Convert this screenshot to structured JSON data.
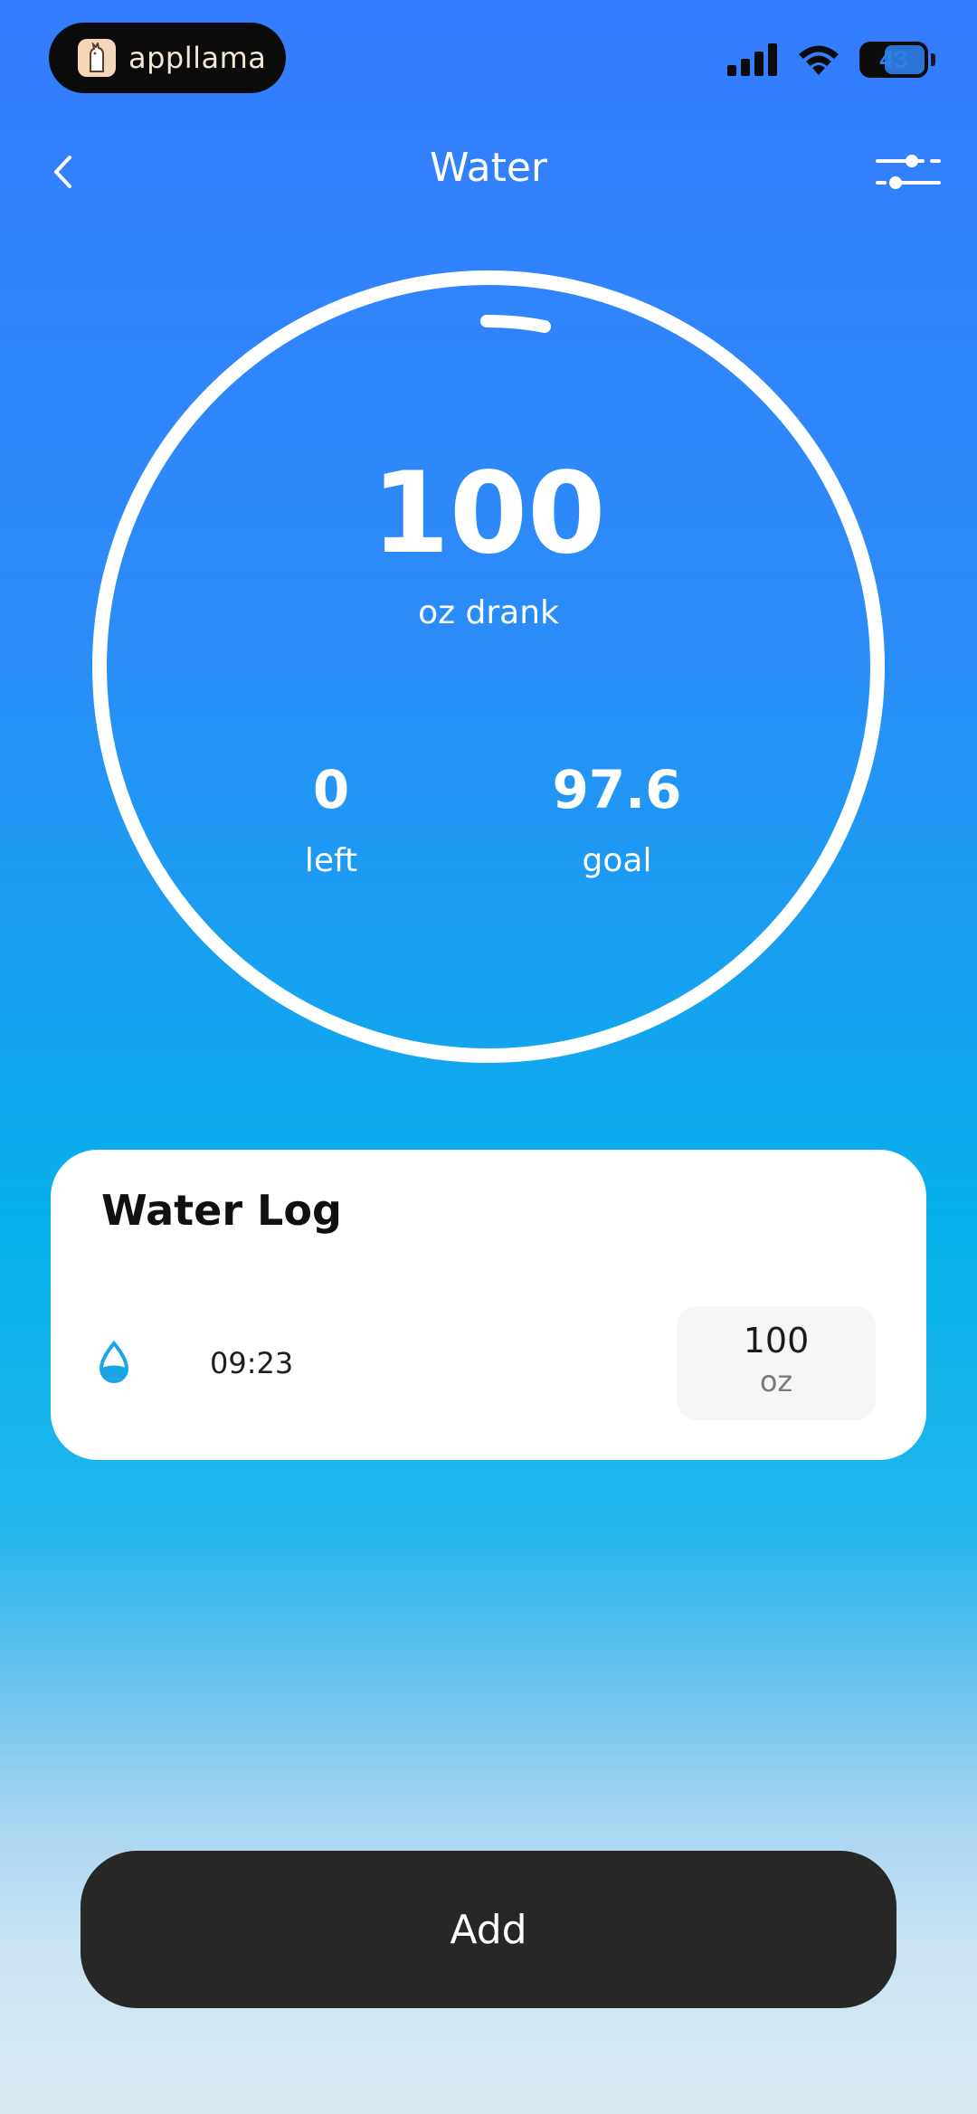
{
  "status_bar": {
    "brand": "appllama",
    "battery": "43"
  },
  "header": {
    "title": "Water"
  },
  "summary": {
    "drank_value": "100",
    "drank_label": "oz drank",
    "left_value": "0",
    "left_label": "left",
    "goal_value": "97.6",
    "goal_label": "goal",
    "progress": 1.0
  },
  "log": {
    "title": "Water Log",
    "entries": [
      {
        "time": "09:23",
        "amount": "100",
        "unit": "oz"
      }
    ]
  },
  "actions": {
    "add_label": "Add"
  },
  "colors": {
    "accent_blue": "#347cff",
    "drop_blue": "#1aa6e6",
    "button_dark": "#272727"
  }
}
